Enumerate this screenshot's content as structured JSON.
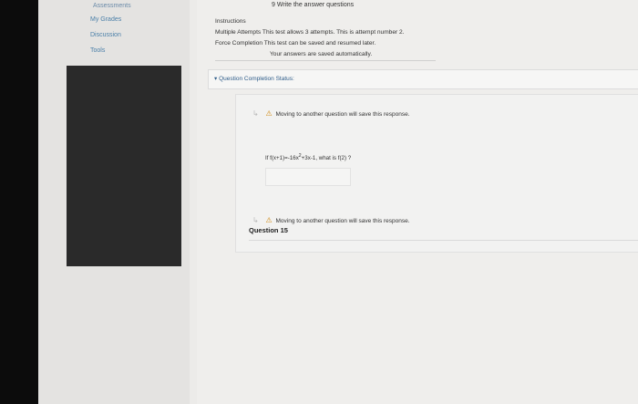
{
  "sidebar": {
    "items": [
      {
        "label": "Assessments"
      },
      {
        "label": "My Grades"
      },
      {
        "label": "Discussion"
      },
      {
        "label": "Tools"
      }
    ]
  },
  "test": {
    "title": "9 Write the answer questions",
    "instructions_label": "Instructions",
    "multiple_attempts": "Multiple Attempts This test allows 3 attempts. This is attempt number 2.",
    "force_completion": "Force Completion This test can be saved and resumed later.",
    "autosave": "Your answers are saved automatically."
  },
  "completion_status": {
    "toggle": "▾",
    "label": "Question Completion Status:"
  },
  "notices": {
    "move_warning": "Moving to another question will save this response."
  },
  "question": {
    "title": "Question 15",
    "text_prefix": "If f(x+1)=-16x",
    "exponent": "2",
    "text_suffix": "+3x-1, what is f(2) ?",
    "answer_value": ""
  },
  "colors": {
    "link": "#4a7fa8",
    "warning": "#d08a14"
  }
}
